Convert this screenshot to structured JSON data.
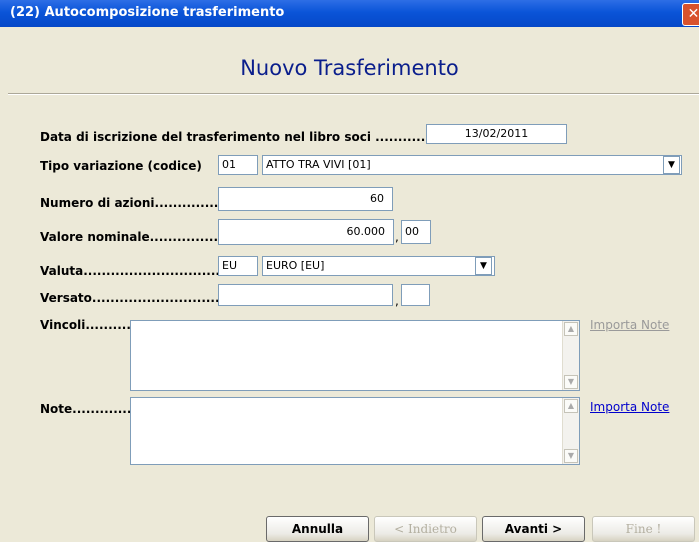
{
  "window": {
    "title": "(22) Autocomposizione trasferimento",
    "close_icon": "x-close-icon"
  },
  "header": {
    "title": "Nuovo Trasferimento"
  },
  "form": {
    "data_iscrizione": {
      "label": "Data di iscrizione del trasferimento nel libro soci ...........",
      "value": "13/02/2011"
    },
    "tipo_variazione": {
      "label": "Tipo variazione (codice)",
      "code": "01",
      "selected": "ATTO TRA VIVI [01]"
    },
    "numero_azioni": {
      "label": "Numero di azioni..................",
      "value": "60"
    },
    "valore_nominale": {
      "label": "Valore nominale.................",
      "value": "60.000",
      "decimals": "00"
    },
    "valuta": {
      "label": "Valuta......................................",
      "code": "EU",
      "selected": "EURO [EU]"
    },
    "versato": {
      "label": "Versato.................................",
      "value": "",
      "decimals": ""
    },
    "vincoli": {
      "label": "Vincoli...........",
      "value": "",
      "import_label": "Importa Note"
    },
    "note": {
      "label": "Note..............",
      "value": "",
      "import_label": "Importa Note"
    }
  },
  "buttons": {
    "annulla": "Annulla",
    "indietro": "< Indietro",
    "avanti": "Avanti >",
    "fine": "Fine !"
  },
  "colors": {
    "titlebar": "#0a54d8",
    "heading": "#0a1e8c",
    "link": "#0000cc",
    "link_disabled": "#9a9a9a"
  }
}
